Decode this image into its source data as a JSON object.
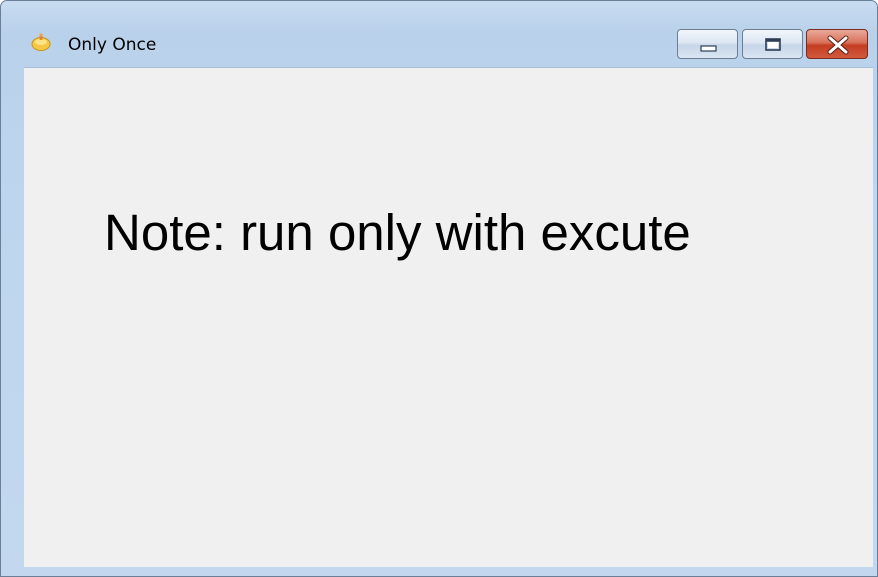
{
  "window": {
    "title": "Only Once",
    "icon": "app-icon",
    "controls": {
      "minimize_icon": "minimize-icon",
      "maximize_icon": "maximize-icon",
      "close_icon": "close-icon"
    }
  },
  "main": {
    "note": "Note: run only with excute"
  },
  "colors": {
    "client_background": "#f0f0f0",
    "frame": "#bdd5ee",
    "close_button": "#c43d22",
    "text": "#000000"
  }
}
